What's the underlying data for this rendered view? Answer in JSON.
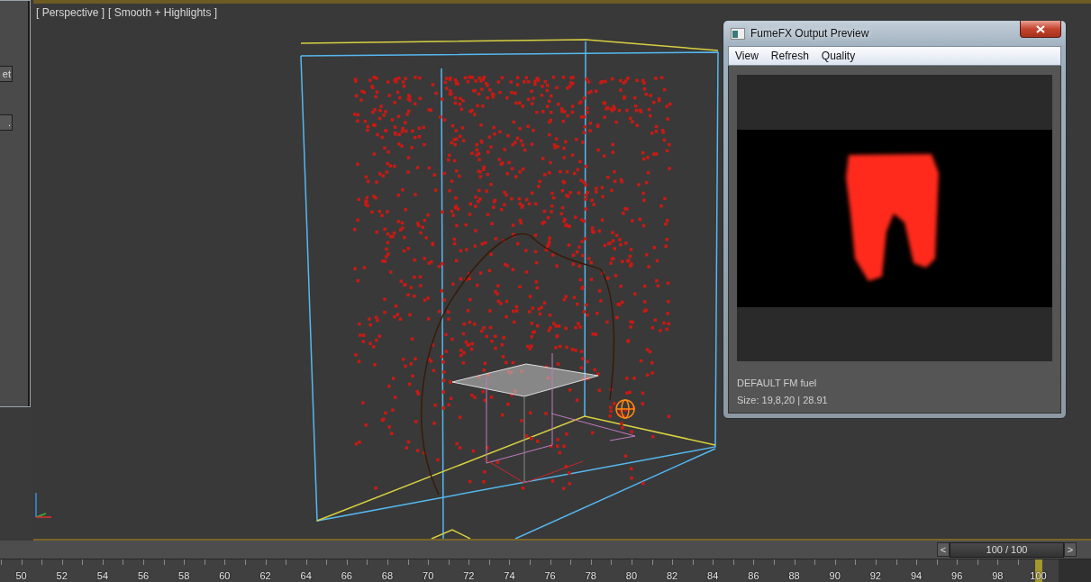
{
  "viewport": {
    "labels": [
      "[ Perspective ]",
      "[ Smooth + Highlights ]"
    ]
  },
  "side_panel": {
    "button_text": "et",
    "small_button_text": "."
  },
  "preview_window": {
    "title": "FumeFX Output Preview",
    "menu": [
      "View",
      "Refresh",
      "Quality"
    ],
    "channel": "DEFAULT FM fuel",
    "size": "Size: 19,8,20 | 28.91"
  },
  "time_slider": {
    "prev": "<",
    "next": ">",
    "frame": "100 / 100"
  },
  "ruler": {
    "labels": [
      "50",
      "52",
      "54",
      "56",
      "58",
      "60",
      "62",
      "64",
      "66",
      "68",
      "70",
      "72",
      "74",
      "76",
      "78",
      "80",
      "82",
      "84",
      "86",
      "88",
      "90",
      "92",
      "94",
      "96",
      "98",
      "100"
    ]
  }
}
